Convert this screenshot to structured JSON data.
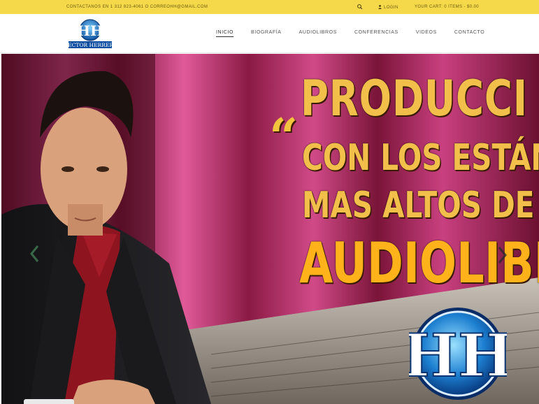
{
  "topbar": {
    "contact": "Contactanos en 1 312 823-4061 o correohh@gmail.com",
    "login": "Login",
    "cart": "Your cart: 0 items - $0.00"
  },
  "logo": {
    "text": "HECTOR HERRERA"
  },
  "nav": {
    "items": [
      {
        "label": "Inicio",
        "active": true
      },
      {
        "label": "Biografía"
      },
      {
        "label": "Audiolibros"
      },
      {
        "label": "Conferencias"
      },
      {
        "label": "Videos"
      },
      {
        "label": "Contacto"
      }
    ]
  },
  "hero": {
    "quote": "“",
    "line1": "PRODUCCI",
    "line2": "CON LOS ESTÁND",
    "line3": "MAS ALTOS DE CA",
    "line4": "AUDIOLIBR"
  },
  "colors": {
    "topbar": "#f6d94a",
    "gold": "#f2c04a",
    "accent_blue": "#1d6fc4",
    "shirt_red": "#8e1420"
  },
  "icons": [
    "search-icon",
    "user-icon",
    "chevron-left-icon",
    "chevron-right-icon"
  ]
}
